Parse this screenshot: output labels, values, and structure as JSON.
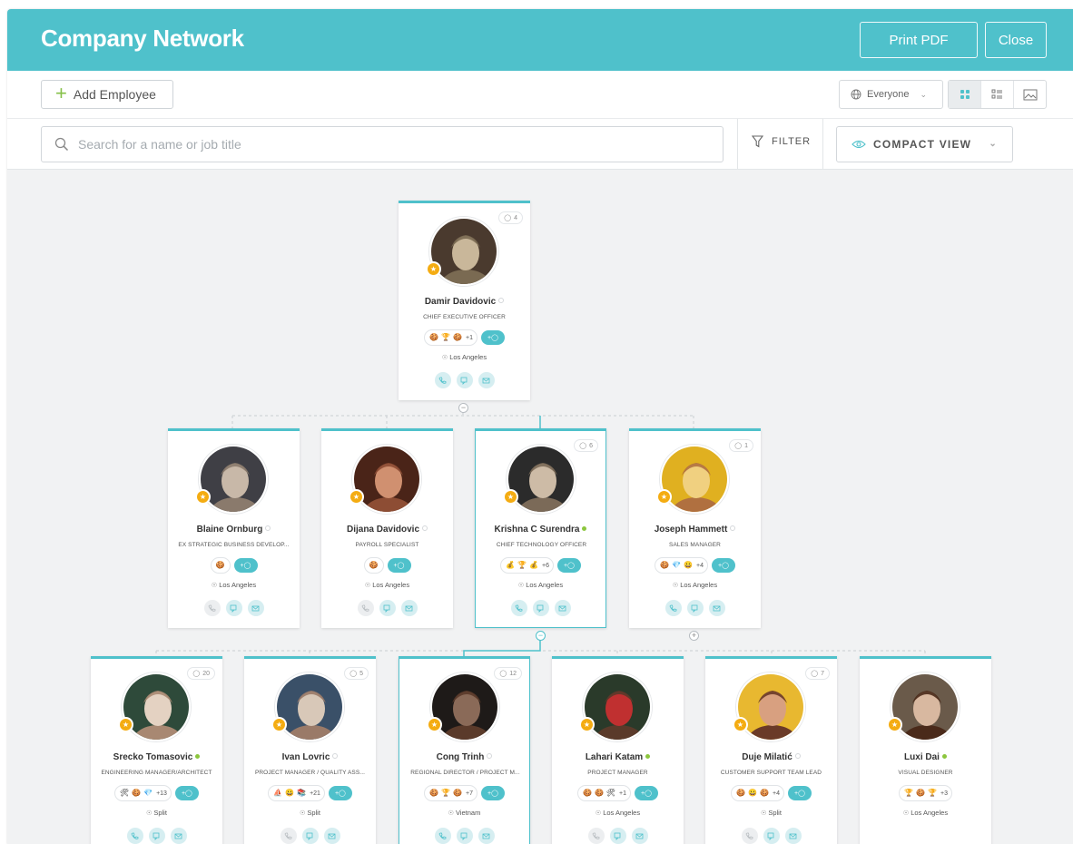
{
  "header": {
    "title": "Company Network",
    "print_label": "Print PDF",
    "close_label": "Close"
  },
  "toolbar": {
    "add_employee_label": "Add Employee",
    "scope_label": "Everyone"
  },
  "search": {
    "placeholder": "Search for a name or job title",
    "filter_label": "FILTER",
    "view_label": "COMPACT VIEW"
  },
  "colors": {
    "accent": "#4fc1cb",
    "star": "#f4ac12",
    "online": "#8cc63e"
  },
  "employees": [
    {
      "name": "Damir Davidovic",
      "title": "CHIEF EXECUTIVE OFFICER",
      "location": "Los Angeles",
      "reports": "4",
      "status": "offline",
      "badges": [
        "🍪",
        "🏆",
        "🍪"
      ],
      "badge_more": "+1",
      "avatar_colors": [
        "#4a3a2e",
        "#7a6a52",
        "#c9b79a"
      ]
    },
    {
      "name": "Blaine Ornburg",
      "title": "EX STRATEGIC BUSINESS DEVELOP...",
      "location": "Los Angeles",
      "reports": "",
      "status": "offline",
      "badges": [
        "🍪"
      ],
      "badge_more": "",
      "avatar_colors": [
        "#3f3f45",
        "#8a7a6c",
        "#c8b8a8"
      ]
    },
    {
      "name": "Dijana Davidovic",
      "title": "PAYROLL SPECIALIST",
      "location": "Los Angeles",
      "reports": "",
      "status": "offline",
      "badges": [
        "🍪"
      ],
      "badge_more": "",
      "avatar_colors": [
        "#4a2418",
        "#8d4d34",
        "#d09070"
      ]
    },
    {
      "name": "Krishna C Surendra",
      "title": "CHIEF TECHNOLOGY OFFICER",
      "location": "Los Angeles",
      "reports": "6",
      "status": "online",
      "badges": [
        "💰",
        "🏆",
        "💰"
      ],
      "badge_more": "+6",
      "avatar_colors": [
        "#2b2b2b",
        "#7b6a58",
        "#cdbba6"
      ]
    },
    {
      "name": "Joseph Hammett",
      "title": "SALES MANAGER",
      "location": "Los Angeles",
      "reports": "1",
      "status": "offline",
      "badges": [
        "🍪",
        "💎",
        "😀"
      ],
      "badge_more": "+4",
      "avatar_colors": [
        "#e0b020",
        "#b07040",
        "#f0d080"
      ]
    },
    {
      "name": "Srecko Tomasovic",
      "title": "ENGINEERING MANAGER/ARCHITECT",
      "location": "Split",
      "reports": "20",
      "status": "online",
      "badges": [
        "🛠",
        "🍪",
        "💎"
      ],
      "badge_more": "+13",
      "avatar_colors": [
        "#2e4a3a",
        "#a88872",
        "#e4d2c2"
      ]
    },
    {
      "name": "Ivan Lovric",
      "title": "PROJECT MANAGER / QUALITY ASS...",
      "location": "Split",
      "reports": "5",
      "status": "offline",
      "badges": [
        "⛵",
        "😀",
        "📚"
      ],
      "badge_more": "+21",
      "avatar_colors": [
        "#3a5068",
        "#9a7a68",
        "#d8c8b8"
      ]
    },
    {
      "name": "Cong Trinh",
      "title": "REGIONAL DIRECTOR / PROJECT M...",
      "location": "Vietnam",
      "reports": "12",
      "status": "offline",
      "badges": [
        "🍪",
        "🏆",
        "🍪"
      ],
      "badge_more": "+7",
      "avatar_colors": [
        "#1e1a18",
        "#5a3a2a",
        "#8a6a58"
      ]
    },
    {
      "name": "Lahari Katam",
      "title": "PROJECT MANAGER",
      "location": "Los Angeles",
      "reports": "",
      "status": "online",
      "badges": [
        "🍪",
        "🍪",
        "🛠"
      ],
      "badge_more": "+1",
      "avatar_colors": [
        "#2a3a2a",
        "#5a3a2a",
        "#c03030"
      ]
    },
    {
      "name": "Duje Milatić",
      "title": "CUSTOMER SUPPORT TEAM LEAD",
      "location": "Split",
      "reports": "7",
      "status": "offline",
      "badges": [
        "🍪",
        "😀",
        "🍪"
      ],
      "badge_more": "+4",
      "avatar_colors": [
        "#e8b830",
        "#6a3a28",
        "#d8a080"
      ]
    },
    {
      "name": "Luxi Dai",
      "title": "VISUAL DESIGNER",
      "location": "Los Angeles",
      "reports": "",
      "status": "online",
      "badges": [
        "🏆",
        "🍪",
        "🏆"
      ],
      "badge_more": "+3",
      "avatar_colors": [
        "#6a5a4a",
        "#4a2a1a",
        "#d8b8a0"
      ]
    }
  ]
}
